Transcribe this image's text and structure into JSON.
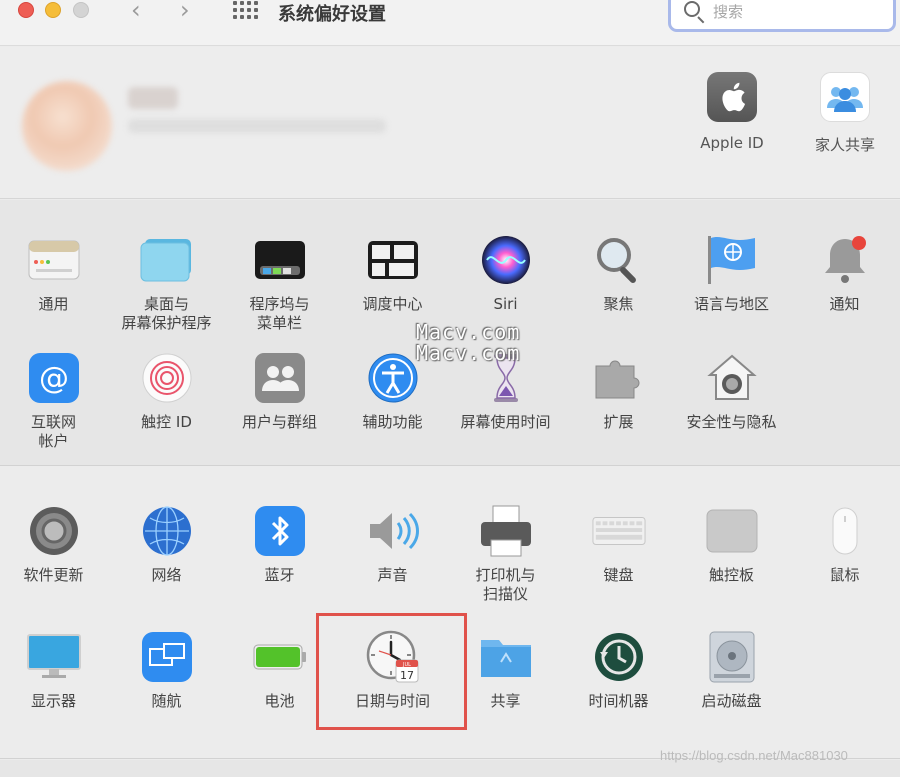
{
  "window": {
    "title": "系统偏好设置"
  },
  "search": {
    "placeholder": "搜索"
  },
  "account": {
    "items": [
      "Apple ID",
      "家人共享"
    ]
  },
  "row1": [
    "通用",
    "桌面与\n屏幕保护程序",
    "程序坞与\n菜单栏",
    "调度中心",
    "Siri",
    "聚焦",
    "语言与地区",
    "通知"
  ],
  "row2": [
    "互联网\n帐户",
    "触控 ID",
    "用户与群组",
    "辅助功能",
    "屏幕使用时间",
    "扩展",
    "安全性与隐私"
  ],
  "row3": [
    "软件更新",
    "网络",
    "蓝牙",
    "声音",
    "打印机与\n扫描仪",
    "键盘",
    "触控板",
    "鼠标"
  ],
  "row4": [
    "显示器",
    "随航",
    "电池",
    "日期与时间",
    "共享",
    "时间机器",
    "启动磁盘"
  ],
  "calendar": {
    "month": "JUL",
    "day": "17"
  },
  "watermark": [
    "Macv.com",
    "Macv.com"
  ],
  "source_watermark": "https://blog.csdn.net/Mac881030",
  "colors": {
    "highlight": "#e0524b",
    "search_focus": "#a9b9ea"
  }
}
